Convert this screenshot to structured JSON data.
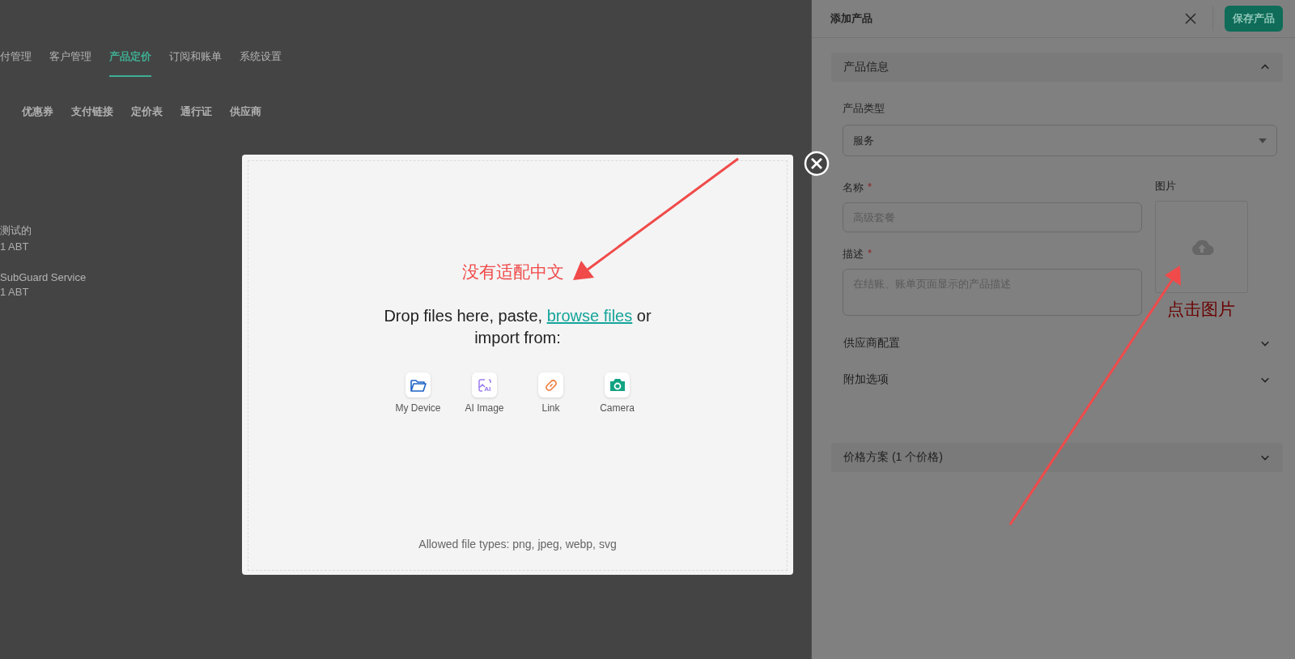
{
  "background_page": {
    "nav_tabs": [
      {
        "label": "付管理",
        "selected": false
      },
      {
        "label": "客户管理",
        "selected": false
      },
      {
        "label": "产品定价",
        "selected": true
      },
      {
        "label": "订阅和账单",
        "selected": false
      },
      {
        "label": "系统设置",
        "selected": false
      }
    ],
    "sub_tabs": [
      "优惠券",
      "支付链接",
      "定价表",
      "通行证",
      "供应商"
    ],
    "products": [
      {
        "name": "测试的",
        "price": "1 ABT"
      },
      {
        "name": "SubGuard Service",
        "price": "1 ABT"
      }
    ]
  },
  "upload_dialog": {
    "text_before": "Drop files here, paste,",
    "browse_link": "browse files",
    "text_after": "or import from:",
    "sources": [
      {
        "kind": "device",
        "label": "My Device"
      },
      {
        "kind": "ai",
        "label": "AI Image",
        "icon_text": "AI"
      },
      {
        "kind": "link",
        "label": "Link"
      },
      {
        "kind": "camera",
        "label": "Camera"
      }
    ],
    "allowed_types": "Allowed file types: png, jpeg, webp, svg"
  },
  "side_panel": {
    "title": "添加产品",
    "save_button": "保存产品",
    "sections": [
      {
        "kind": "card",
        "title": "产品信息",
        "expanded": true
      },
      {
        "kind": "plain",
        "title": "供应商配置",
        "expanded": false
      },
      {
        "kind": "plain",
        "title": "附加选项",
        "expanded": false
      },
      {
        "kind": "card",
        "title": "价格方案 (1 个价格)",
        "expanded": false
      }
    ],
    "product_type": {
      "label": "产品类型",
      "value": "服务"
    },
    "name": {
      "label": "名称",
      "required": true,
      "required_mark": "*",
      "placeholder": "高级套餐"
    },
    "description": {
      "label": "描述",
      "required": true,
      "required_mark": "*",
      "placeholder": "在结账、账单页面显示的产品描述"
    },
    "image": {
      "label": "图片"
    }
  },
  "annotations": [
    "没有适配中文",
    "点击图片"
  ]
}
